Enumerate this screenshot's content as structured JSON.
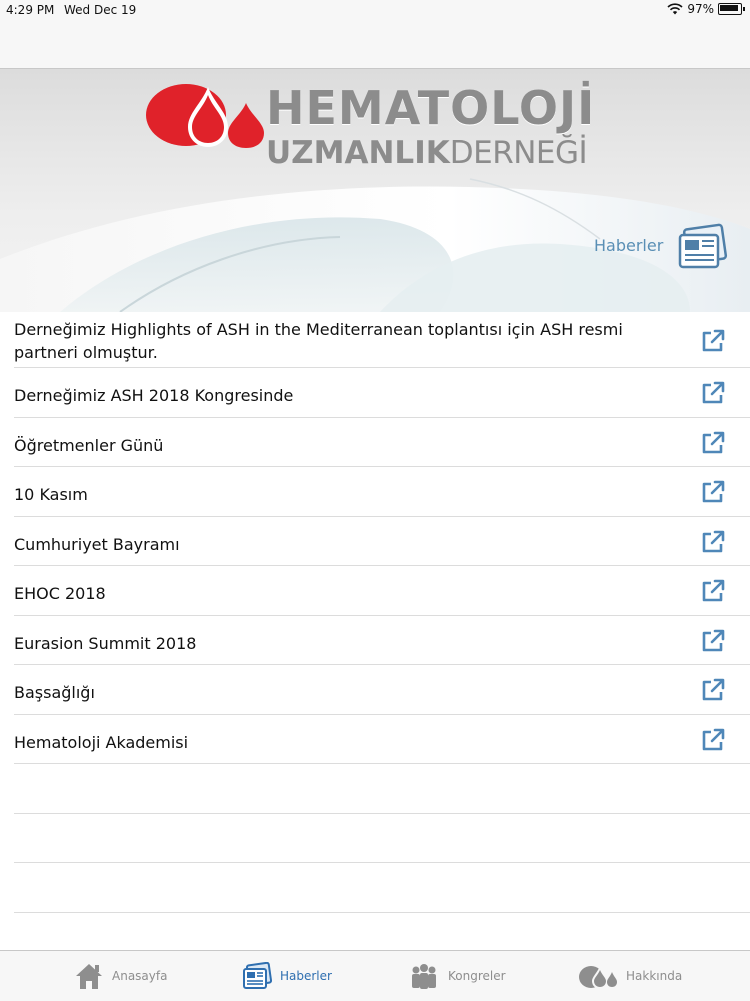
{
  "status_bar": {
    "time": "4:29 PM",
    "date": "Wed Dec 19",
    "battery": "97%"
  },
  "header": {
    "logo_line1": "HEMATOLOJİ",
    "logo_line2_bold": "UZMANLIK",
    "logo_line2_light": "DERNEĞİ",
    "section_title": "Haberler"
  },
  "news": [
    {
      "title": "Derneğimiz Highlights of ASH in the Mediterranean toplantısı için ASH resmi partneri olmuştur."
    },
    {
      "title": "Derneğimiz ASH 2018 Kongresinde"
    },
    {
      "title": "Öğretmenler Günü"
    },
    {
      "title": "10 Kasım"
    },
    {
      "title": "Cumhuriyet Bayramı"
    },
    {
      "title": "EHOC 2018"
    },
    {
      "title": "Eurasion Summit 2018"
    },
    {
      "title": "Başsağlığı"
    },
    {
      "title": "Hematoloji Akademisi"
    }
  ],
  "tabs": [
    {
      "label": "Anasayfa",
      "icon": "home-icon"
    },
    {
      "label": "Haberler",
      "icon": "newspaper-icon",
      "active": true
    },
    {
      "label": "Kongreler",
      "icon": "people-icon"
    },
    {
      "label": "Hakkında",
      "icon": "drop-icon"
    }
  ],
  "colors": {
    "brand_red": "#e0222a",
    "link_blue": "#5a8fb5",
    "tab_active": "#2f6fb0",
    "logo_gray": "#8c8c8c"
  }
}
